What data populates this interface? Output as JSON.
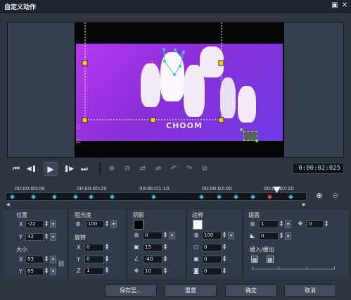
{
  "window": {
    "title": "自定义动作",
    "maximize_icon": "maximize-icon",
    "close_icon": "close-icon"
  },
  "preview": {
    "overlay_text": "CHOOM"
  },
  "playback": {
    "buttons": [
      {
        "name": "go-to-start-button",
        "glyph": "⏮"
      },
      {
        "name": "previous-frame-button",
        "glyph": "◀❚"
      },
      {
        "name": "play-button",
        "glyph": "▶"
      },
      {
        "name": "next-frame-button",
        "glyph": "❚▶"
      },
      {
        "name": "go-to-end-button",
        "glyph": "⏭"
      }
    ],
    "keyframe_buttons": [
      "add-keyframe-icon",
      "remove-keyframe-icon",
      "reverse-keyframe-icon",
      "swap-keyframe-icon",
      "move-left-keyframe-icon",
      "move-right-keyframe-icon",
      "copy-keyframe-icon"
    ],
    "timecode": "0:00:02:025"
  },
  "timeline": {
    "labels": [
      "00:00:00:00",
      "00:00:00:20",
      "00:00:01:10",
      "00:00:02:00",
      "00:00:02:20"
    ],
    "zoom_in_icon": "zoom-in-icon",
    "zoom_out_icon": "zoom-out-icon"
  },
  "position": {
    "title": "位置",
    "x_label": "X",
    "x": "-22",
    "y_label": "Y",
    "y": "42"
  },
  "size": {
    "title": "大小",
    "x_label": "X",
    "x": "83",
    "y_label": "Y",
    "y": "85",
    "link_icon": "link-icon"
  },
  "opacity": {
    "title": "阻光度",
    "value": "100"
  },
  "rotation": {
    "title": "旋转",
    "x_label": "X",
    "x": "0",
    "y_label": "Y",
    "y": "0",
    "z_label": "Z",
    "z": "1"
  },
  "shadow": {
    "title": "阴影",
    "color": "#000000",
    "opacity": "0",
    "blur": "15",
    "angle": "-40",
    "distance": "10"
  },
  "border": {
    "title": "边界",
    "color": "#ffffff",
    "opacity": "100",
    "width": "0",
    "radius": "0",
    "size": "0"
  },
  "mirror": {
    "title": "镜面",
    "opacity": "1",
    "offset": "0",
    "fade": "0"
  },
  "ease": {
    "title": "缓入/缓出"
  },
  "footer": {
    "save_to": "保存至...",
    "reset": "重置",
    "ok": "确定",
    "cancel": "取消"
  }
}
